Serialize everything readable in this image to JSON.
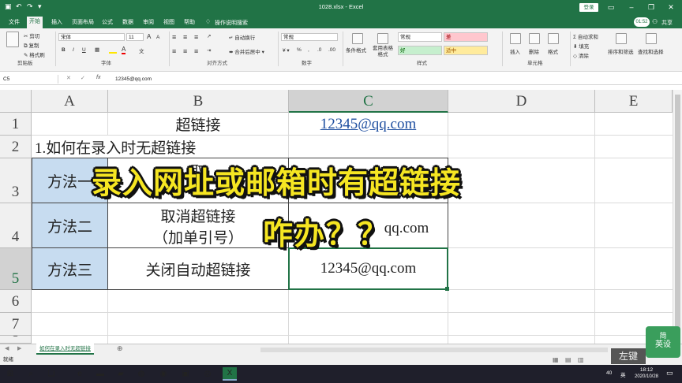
{
  "titlebar": {
    "title": "1028.xlsx - Excel",
    "login": "登录",
    "avatar_time": "01:52"
  },
  "menu": [
    "文件",
    "开始",
    "插入",
    "页面布局",
    "公式",
    "数据",
    "审阅",
    "视图",
    "帮助"
  ],
  "menu_search": "操作说明搜索",
  "menu_share": "共享",
  "ribbon": {
    "clipboard": {
      "cut": "剪切",
      "copy": "复制",
      "painter": "格式刷",
      "label": "剪贴板"
    },
    "font": {
      "name": "宋体",
      "size": "11",
      "label": "字体",
      "bold": "B",
      "italic": "I",
      "underline": "U"
    },
    "align": {
      "wrap": "自动换行",
      "merge": "合并后居中",
      "label": "对齐方式"
    },
    "number": {
      "format": "常规",
      "label": "数字"
    },
    "styles": {
      "cond": "条件格式",
      "table": "套用表格格式",
      "normal": "常规",
      "bad": "差",
      "good": "好",
      "neutral": "适中",
      "label": "样式"
    },
    "cells": {
      "insert": "插入",
      "delete": "删除",
      "format": "格式",
      "label": "单元格"
    },
    "edit": {
      "autosum": "自动求和",
      "fill": "填充",
      "clear": "清除",
      "sort": "排序和筛选",
      "find": "查找和选择"
    }
  },
  "formula_bar": {
    "name_box": "C5",
    "fx": "fx",
    "content": "12345@qq.com"
  },
  "columns": [
    "A",
    "B",
    "C",
    "D",
    "E"
  ],
  "rows": [
    "1",
    "2",
    "3",
    "4",
    "5",
    "6",
    "7",
    "8"
  ],
  "cells": {
    "b1": "超链接",
    "c1": "12345@qq.com",
    "a2": "1.如何在录入时无超链接",
    "a3": "方法一",
    "b3": "取",
    "a4": "方法二",
    "b4_line1": "取消超链接",
    "b4_line2": "（加单引号）",
    "c4": "qq.com",
    "a5": "方法三",
    "b5": "关闭自动超链接",
    "c5": "12345@qq.com"
  },
  "overlay": {
    "line1": "录入网址或邮箱时有超链接",
    "line2": "咋办？？"
  },
  "sheet_tab": "如何在录入时无超链接",
  "status": "就绪",
  "taskbar": {
    "time": "18:12",
    "date": "2020/10/28",
    "lang": "英",
    "vol": "40"
  },
  "brand": {
    "line1": "简",
    "line2": "英设"
  },
  "watermark": "左键"
}
